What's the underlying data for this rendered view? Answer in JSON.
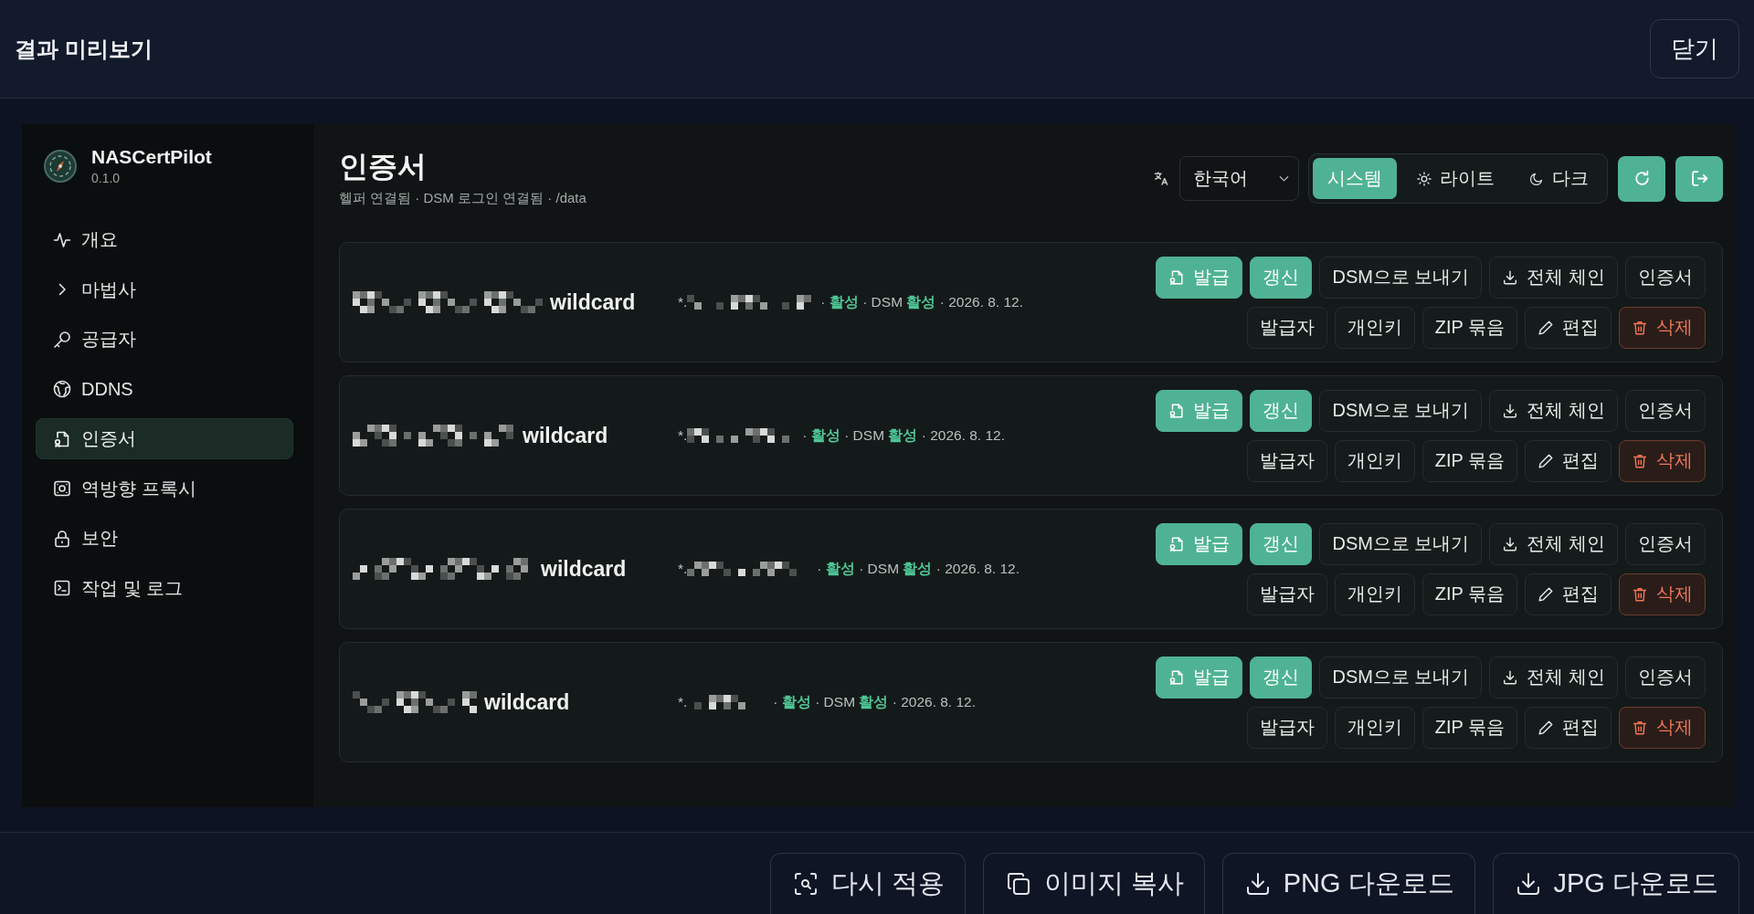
{
  "dialog": {
    "title": "결과 미리보기",
    "close_button": "닫기"
  },
  "sidebar": {
    "app_name": "NASCertPilot",
    "version": "0.1.0",
    "items": [
      {
        "label": "개요",
        "selected": false
      },
      {
        "label": "마법사",
        "selected": false
      },
      {
        "label": "공급자",
        "selected": false
      },
      {
        "label": "DDNS",
        "selected": false
      },
      {
        "label": "인증서",
        "selected": true
      },
      {
        "label": "역방향 프록시",
        "selected": false
      },
      {
        "label": "보안",
        "selected": false
      },
      {
        "label": "작업 및 로그",
        "selected": false
      }
    ]
  },
  "page": {
    "title": "인증서",
    "subtitle": "헬퍼 연결됨 · DSM 로그인 연결됨 · /data",
    "language": {
      "value": "한국어"
    },
    "theme_options": [
      {
        "label": "시스템",
        "selected": true
      },
      {
        "label": "라이트",
        "selected": false
      },
      {
        "label": "다크",
        "selected": false
      }
    ]
  },
  "certificates": [
    {
      "name": "wildcard",
      "domain_prefix": "*.",
      "meta": [
        {
          "kind": "text",
          "text": "·"
        },
        {
          "kind": "ok",
          "text": "활성"
        },
        {
          "kind": "text",
          "text": "· DSM"
        },
        {
          "kind": "ok",
          "text": "활성"
        },
        {
          "kind": "text",
          "text": "· 2026. 8. 12."
        }
      ],
      "action_rows": [
        [
          {
            "label": "발급",
            "kind": "primary"
          },
          {
            "label": "갱신",
            "kind": "primary"
          },
          {
            "label": "DSM으로 보내기",
            "kind": "secondary"
          },
          {
            "label": "전체 체인",
            "kind": "secondary"
          },
          {
            "label": "인증서",
            "kind": "secondary"
          }
        ],
        [
          {
            "label": "발급자",
            "kind": "secondary"
          },
          {
            "label": "개인키",
            "kind": "secondary"
          },
          {
            "label": "ZIP 묶음",
            "kind": "secondary"
          },
          {
            "label": "편집",
            "kind": "secondary"
          },
          {
            "label": "삭제",
            "kind": "danger"
          }
        ]
      ]
    },
    {
      "name": "wildcard",
      "domain_prefix": "*.",
      "meta": [
        {
          "kind": "text",
          "text": "·"
        },
        {
          "kind": "ok",
          "text": "활성"
        },
        {
          "kind": "text",
          "text": "· DSM"
        },
        {
          "kind": "ok",
          "text": "활성"
        },
        {
          "kind": "text",
          "text": "· 2026. 8. 12."
        }
      ],
      "action_rows": [
        [
          {
            "label": "발급",
            "kind": "primary"
          },
          {
            "label": "갱신",
            "kind": "primary"
          },
          {
            "label": "DSM으로 보내기",
            "kind": "secondary"
          },
          {
            "label": "전체 체인",
            "kind": "secondary"
          },
          {
            "label": "인증서",
            "kind": "secondary"
          }
        ],
        [
          {
            "label": "발급자",
            "kind": "secondary"
          },
          {
            "label": "개인키",
            "kind": "secondary"
          },
          {
            "label": "ZIP 묶음",
            "kind": "secondary"
          },
          {
            "label": "편집",
            "kind": "secondary"
          },
          {
            "label": "삭제",
            "kind": "danger"
          }
        ]
      ]
    },
    {
      "name": "wildcard",
      "domain_prefix": "*.",
      "meta": [
        {
          "kind": "text",
          "text": "·"
        },
        {
          "kind": "ok",
          "text": "활성"
        },
        {
          "kind": "text",
          "text": "· DSM"
        },
        {
          "kind": "ok",
          "text": "활성"
        },
        {
          "kind": "text",
          "text": "· 2026. 8. 12."
        }
      ],
      "action_rows": [
        [
          {
            "label": "발급",
            "kind": "primary"
          },
          {
            "label": "갱신",
            "kind": "primary"
          },
          {
            "label": "DSM으로 보내기",
            "kind": "secondary"
          },
          {
            "label": "전체 체인",
            "kind": "secondary"
          },
          {
            "label": "인증서",
            "kind": "secondary"
          }
        ],
        [
          {
            "label": "발급자",
            "kind": "secondary"
          },
          {
            "label": "개인키",
            "kind": "secondary"
          },
          {
            "label": "ZIP 묶음",
            "kind": "secondary"
          },
          {
            "label": "편집",
            "kind": "secondary"
          },
          {
            "label": "삭제",
            "kind": "danger"
          }
        ]
      ]
    },
    {
      "name": "wildcard",
      "domain_prefix": "*.",
      "meta": [
        {
          "kind": "text",
          "text": "·"
        },
        {
          "kind": "ok",
          "text": "활성"
        },
        {
          "kind": "text",
          "text": "· DSM"
        },
        {
          "kind": "ok",
          "text": "활성"
        },
        {
          "kind": "text",
          "text": "· 2026. 8. 12."
        }
      ],
      "action_rows": [
        [
          {
            "label": "발급",
            "kind": "primary"
          },
          {
            "label": "갱신",
            "kind": "primary"
          },
          {
            "label": "DSM으로 보내기",
            "kind": "secondary"
          },
          {
            "label": "전체 체인",
            "kind": "secondary"
          },
          {
            "label": "인증서",
            "kind": "secondary"
          }
        ],
        [
          {
            "label": "발급자",
            "kind": "secondary"
          },
          {
            "label": "개인키",
            "kind": "secondary"
          },
          {
            "label": "ZIP 묶음",
            "kind": "secondary"
          },
          {
            "label": "편집",
            "kind": "secondary"
          },
          {
            "label": "삭제",
            "kind": "danger"
          }
        ]
      ]
    }
  ],
  "footer_buttons": [
    "다시 적용",
    "이미지 복사",
    "PNG 다운로드",
    "JPG 다운로드"
  ]
}
